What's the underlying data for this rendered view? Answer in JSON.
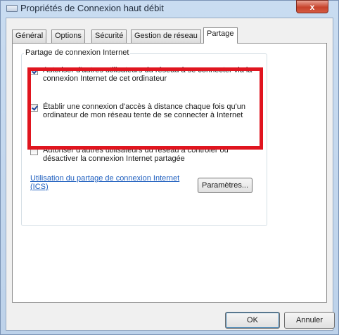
{
  "window": {
    "title": "Propriétés de Connexion haut débit",
    "close_label": "x"
  },
  "tabs": [
    {
      "label": "Général",
      "active": false
    },
    {
      "label": "Options",
      "active": false
    },
    {
      "label": "Sécurité",
      "active": false
    },
    {
      "label": "Gestion de réseau",
      "active": false
    },
    {
      "label": "Partage",
      "active": true
    }
  ],
  "sharing": {
    "group_label": "Partage de connexion Internet",
    "options": [
      {
        "label": "Autoriser d'autres utilisateurs du réseau à se connecter via la connexion Internet de cet ordinateur",
        "checked": true
      },
      {
        "label": "Établir une connexion d'accès à distance chaque fois qu'un ordinateur de mon réseau tente de se connecter à Internet",
        "checked": true
      },
      {
        "label": "Autoriser d'autres utilisateurs du réseau à contrôler ou désactiver la connexion Internet partagée",
        "checked": false
      }
    ],
    "link_text": "Utilisation du partage de connexion Internet (ICS)",
    "params_label": "Paramètres..."
  },
  "buttons": {
    "ok_label": "OK",
    "cancel_label": "Annuler"
  },
  "colors": {
    "highlight": "#e0151f",
    "link": "#1f5fbf",
    "title_bar": "#c9dcf1",
    "close_button": "#c7432c"
  }
}
